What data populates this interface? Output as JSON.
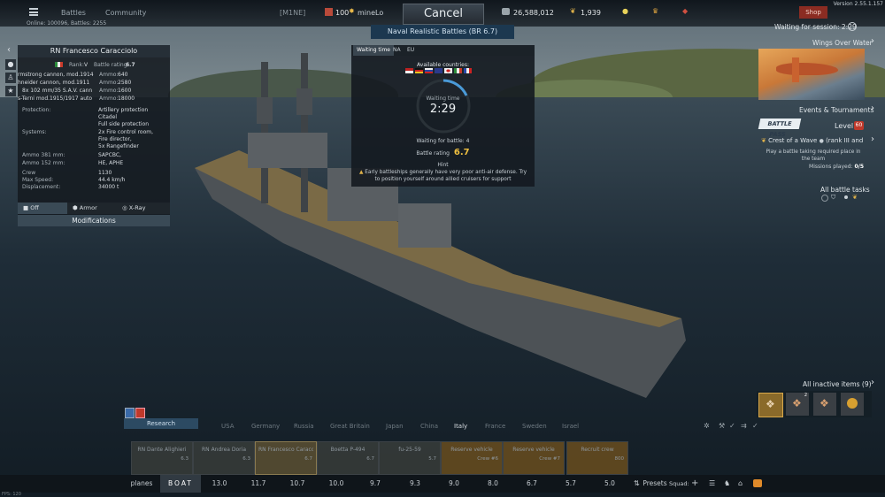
{
  "topbar": {
    "menu_icon": "hamburger-icon",
    "nav": [
      "Battles",
      "Community"
    ],
    "online": "Online: 100096, Battles: 2255",
    "squad_tag": "[M1NE]",
    "player_level": "100",
    "player_name": "mineLo",
    "cancel_label": "Cancel",
    "silver": "26,588,012",
    "gold": "1,939",
    "shop_label": "Shop",
    "version": "Version 2.55.1.157",
    "waiting_session": "Waiting for session: 2:29"
  },
  "mode_bar": "Naval Realistic Battles (BR 6.7)",
  "vehicle_panel": {
    "name": "RN Francesco Caracciolo",
    "rank_label": "Rank:",
    "rank": "V",
    "br_label": "Battle rating:",
    "br": "6.7",
    "weapons": [
      {
        "text": "rmstrong cannon, mod.1914",
        "ammo_label": "Ammo:",
        "ammo": "640"
      },
      {
        "text": "hneider cannon, mod.1911",
        "ammo_label": "Ammo:",
        "ammo": "2580"
      },
      {
        "text": "8x    102 mm/35 S.A.V. cann",
        "ammo_label": "Ammo:",
        "ammo": "1600"
      },
      {
        "text": "s-Terni mod.1915/1917 auto",
        "ammo_label": "Ammo:",
        "ammo": "18000"
      }
    ],
    "stats": [
      {
        "label": "Protection:",
        "value": "Artillery protection"
      },
      {
        "label": "",
        "value": "Citadel"
      },
      {
        "label": "",
        "value": "Full side protection"
      },
      {
        "label": "Systems:",
        "value": "2x Fire control room,"
      },
      {
        "label": "",
        "value": "Fire director,"
      },
      {
        "label": "",
        "value": "5x Rangefinder"
      },
      {
        "label": "Ammo 381 mm:",
        "value": "SAPCBC,"
      },
      {
        "label": "Ammo 152 mm:",
        "value": "HE, APHE"
      },
      {
        "label": "Crew",
        "value": "1130"
      },
      {
        "label": "Max Speed:",
        "value": "44.4 km/h"
      },
      {
        "label": "Displacement:",
        "value": "34000 t"
      }
    ],
    "view_modes": [
      "Off",
      "Armor",
      "X-Ray"
    ],
    "modifications": "Modifications"
  },
  "waiting_panel": {
    "tabs": [
      "Waiting time",
      "NA",
      "EU"
    ],
    "available": "Available countries:",
    "waiting_time_label": "Waiting time",
    "waiting_time": "2:29",
    "waiting_for_battle": "Waiting for battle: 4",
    "br_label": "Battle rating",
    "br": "6.7",
    "hint_title": "Hint",
    "hint": "Early battleships generally have very poor anti-air defense. Try to position yourself around allied cruisers for support"
  },
  "right_panel": {
    "wings": "Wings Over Water",
    "events": "Events & Tournaments",
    "battle_pass": "BATTLE PASS",
    "level_label": "Level",
    "level": "60",
    "task_title": "Crest of a Wave",
    "task_rank": "(rank III and",
    "task_desc": "Play a battle taking required place in the team",
    "missions_label": "Missions played:",
    "missions": "0/5",
    "all_tasks": "All battle tasks",
    "inactive": "All inactive items (9)",
    "item_counts": [
      "",
      "2",
      "",
      ""
    ]
  },
  "research": "Research",
  "nations": [
    "USA",
    "Germany",
    "Russia",
    "Great Britain",
    "Japan",
    "China",
    "Italy",
    "France",
    "Sweden",
    "Israel"
  ],
  "vehicles": [
    {
      "name": "RN Dante Alighieri",
      "br": "6.3"
    },
    {
      "name": "RN Andrea Doria",
      "br": "6.3"
    },
    {
      "name": "RN Francesco Caracciolo",
      "br": "6.7"
    },
    {
      "name": "Boetta P-494",
      "br": "6.7"
    },
    {
      "name": "fu-25-59",
      "br": "5.7"
    },
    {
      "name": "Reserve vehicle",
      "br": "Crew #6"
    },
    {
      "name": "Reserve vehicle",
      "br": "Crew #7"
    },
    {
      "name": "Recruit crew",
      "br": "800"
    }
  ],
  "br_bar": [
    "planes",
    "BOAT",
    "13.0",
    "11.7",
    "10.7",
    "10.0",
    "9.7",
    "9.3",
    "9.0",
    "8.0",
    "6.7",
    "5.7",
    "5.0"
  ],
  "presets": "Presets",
  "squad": "Squad:",
  "fps": "FPS: 120"
}
